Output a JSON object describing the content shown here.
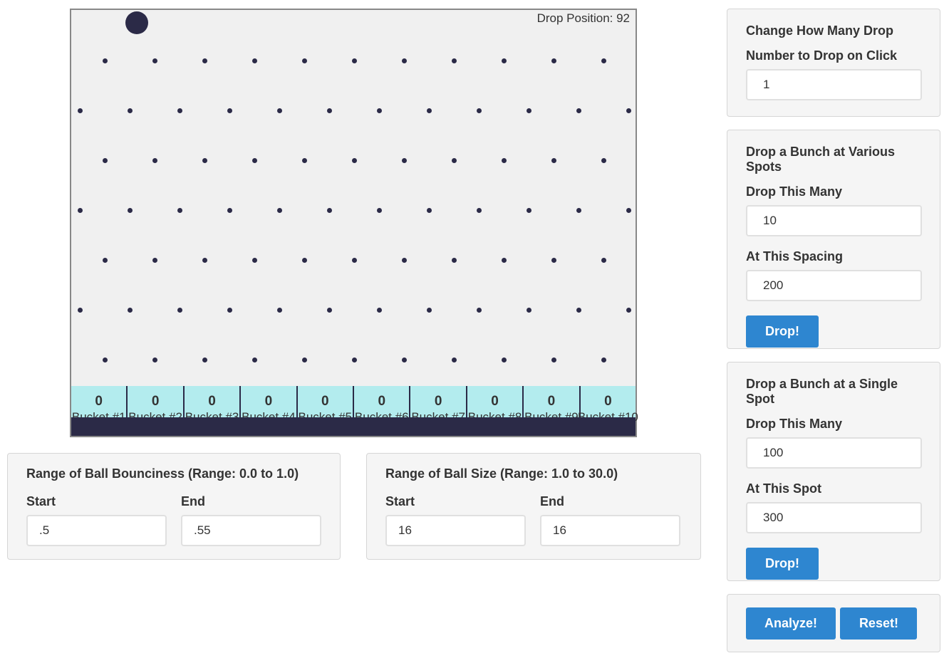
{
  "board": {
    "drop_position_label": "Drop Position: 92",
    "buckets": [
      {
        "count": "0",
        "label": "Bucket #1"
      },
      {
        "count": "0",
        "label": "Bucket #2"
      },
      {
        "count": "0",
        "label": "Bucket #3"
      },
      {
        "count": "0",
        "label": "Bucket #4"
      },
      {
        "count": "0",
        "label": "Bucket #5"
      },
      {
        "count": "0",
        "label": "Bucket #6"
      },
      {
        "count": "0",
        "label": "Bucket #7"
      },
      {
        "count": "0",
        "label": "Bucket #8"
      },
      {
        "count": "0",
        "label": "Bucket #9"
      },
      {
        "count": "0",
        "label": "Bucket #10"
      }
    ],
    "colors": {
      "peg": "#2b2a47",
      "bucket_bg": "#b3ecee",
      "floor": "#2b2a47",
      "board_bg": "#f0f0f0"
    }
  },
  "bounciness": {
    "title": "Range of Ball Bounciness (Range: 0.0 to 1.0)",
    "start_label": "Start",
    "start_value": ".5",
    "end_label": "End",
    "end_value": ".55"
  },
  "size": {
    "title": "Range of Ball Size (Range: 1.0 to 30.0)",
    "start_label": "Start",
    "start_value": "16",
    "end_label": "End",
    "end_value": "16"
  },
  "change_drop": {
    "title": "Change How Many Drop",
    "field_label": "Number to Drop on Click",
    "value": "1"
  },
  "various_spots": {
    "title": "Drop a Bunch at Various Spots",
    "many_label": "Drop This Many",
    "many_value": "10",
    "spacing_label": "At This Spacing",
    "spacing_value": "200",
    "button": "Drop!"
  },
  "single_spot": {
    "title": "Drop a Bunch at a Single Spot",
    "many_label": "Drop This Many",
    "many_value": "100",
    "spot_label": "At This Spot",
    "spot_value": "300",
    "button": "Drop!"
  },
  "actions": {
    "analyze": "Analyze!",
    "reset": "Reset!",
    "accent": "#2e86d0"
  }
}
